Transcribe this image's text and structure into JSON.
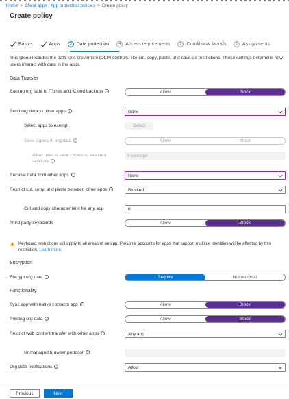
{
  "breadcrumb": {
    "home": "Home",
    "sep1": ">",
    "client": "Client apps | App protection policies",
    "sep2": ">",
    "current": "Create policy"
  },
  "title": "Create policy",
  "steps": [
    {
      "label": "Basics",
      "state": "done"
    },
    {
      "label": "Apps",
      "state": "done"
    },
    {
      "num": "3",
      "label": "Data protection",
      "state": "active"
    },
    {
      "num": "4",
      "label": "Access requirements",
      "state": "todo"
    },
    {
      "num": "5",
      "label": "Conditional launch",
      "state": "todo"
    },
    {
      "num": "6",
      "label": "Assignments",
      "state": "todo"
    }
  ],
  "intro": "This group includes the data loss prevention (DLP) controls, like cut, copy, paste, and save-as restrictions. These settings determine how users interact with data in the apps.",
  "sections": {
    "transfer": "Data Transfer",
    "encryption": "Encryption",
    "functionality": "Functionality"
  },
  "fields": {
    "backup": {
      "label": "Backup org data to iTunes and iCloud backups",
      "allow": "Allow",
      "block": "Block"
    },
    "send": {
      "label": "Send org data to other apps",
      "value": "None"
    },
    "exempt": {
      "label": "Select apps to exempt",
      "button": "Select"
    },
    "save_copies": {
      "label": "Save copies of org data",
      "allow": "Allow",
      "block": "Block"
    },
    "allow_save": {
      "label": "Allow user to save copies to selected services",
      "value": "0 selected"
    },
    "receive": {
      "label": "Receive data from other apps",
      "value": "None"
    },
    "restrict_ccp": {
      "label": "Restrict cut, copy, and paste between other apps",
      "value": "Blocked"
    },
    "char_limit": {
      "label": "Cut and copy character limit for any app",
      "value": "0"
    },
    "keyboards": {
      "label": "Third party keyboards",
      "allow": "Allow",
      "block": "Block"
    },
    "encrypt": {
      "label": "Encrypt org data",
      "require": "Require",
      "not_required": "Not required"
    },
    "sync": {
      "label": "Sync app with native contacts app",
      "allow": "Allow",
      "block": "Block"
    },
    "printing": {
      "label": "Printing org data",
      "allow": "Allow",
      "block": "Block"
    },
    "web": {
      "label": "Restrict web content transfer with other apps",
      "value": "Any app"
    },
    "browser": {
      "label": "Unmanaged browser protocol",
      "value": ""
    },
    "notify": {
      "label": "Org data notifications",
      "value": "Allow"
    }
  },
  "warning": {
    "text": "Keyboard restrictions will apply to all areas of an app. Personal accounts for apps that support multiple identities will be affected by this restriction. ",
    "link": "Learn more."
  },
  "buttons": {
    "previous": "Previous",
    "next": "Next"
  },
  "info_glyph": "i",
  "colors": {
    "accent": "#0078d4",
    "toggle_selected": "#5c2e91",
    "warning": "#ffb900"
  }
}
